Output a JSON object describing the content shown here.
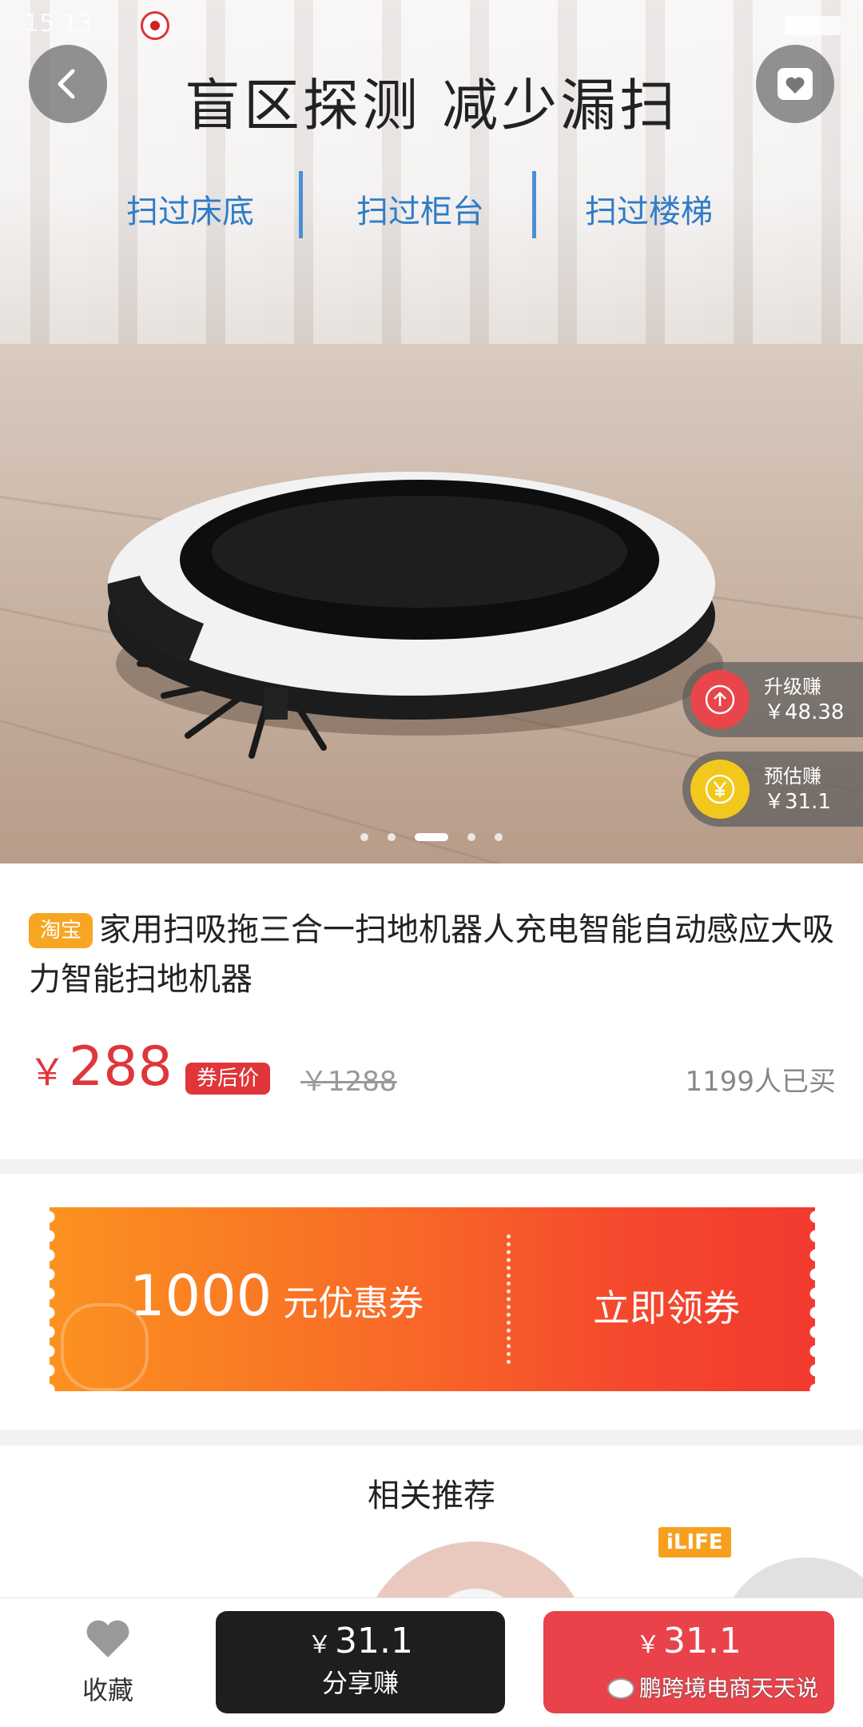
{
  "status_bar": {
    "time": "15:13"
  },
  "hero": {
    "title": "盲区探测 减少漏扫",
    "features": [
      "扫过床底",
      "扫过柜台",
      "扫过楼梯"
    ],
    "earn_upgrade": {
      "label": "升级赚",
      "value": "￥48.38"
    },
    "earn_estimate": {
      "label": "预估赚",
      "value": "￥31.1"
    },
    "carousel": {
      "count": 5,
      "active_index": 2
    }
  },
  "product": {
    "platform_tag": "淘宝",
    "title": "家用扫吸拖三合一扫地机器人充电智能自动感应大吸力智能扫地机器",
    "currency": "￥",
    "price": "288",
    "price_tag": "券后价",
    "original_price": "￥1288",
    "sold": "1199人已买"
  },
  "coupon": {
    "amount": "1000",
    "unit": "元优惠券",
    "cta": "立即领券"
  },
  "related": {
    "title": "相关推荐",
    "brand_tag": "iLIFE"
  },
  "bottom_bar": {
    "favorite_label": "收藏",
    "share": {
      "currency": "￥",
      "price": "31.1",
      "label": "分享赚"
    },
    "buy": {
      "currency": "￥",
      "price": "31.1"
    }
  },
  "watermark": "鹏跨境电商天天说",
  "colors": {
    "price_red": "#e0353a",
    "coupon_orange": "#fb9220",
    "coupon_red": "#f23a2f",
    "feature_blue": "#2f7cc8",
    "tb_orange": "#f7a623"
  }
}
